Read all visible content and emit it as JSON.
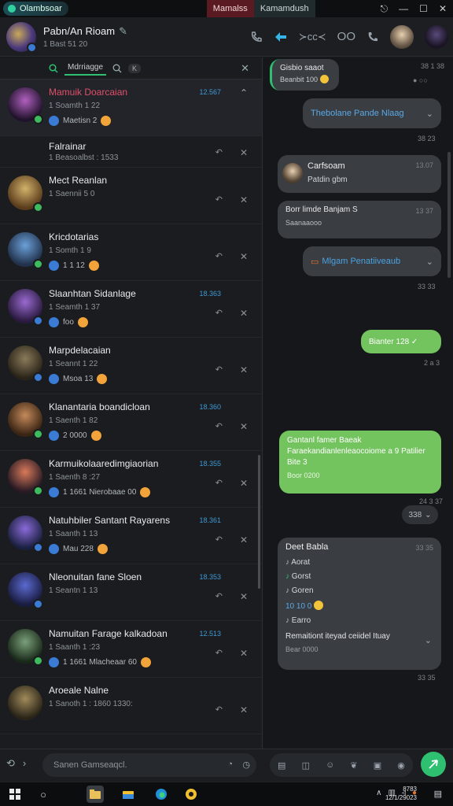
{
  "titlebar": {
    "app_name": "Olambsoar",
    "tab_active": "Mamalss",
    "tab_inactive": "Kamamdush",
    "controls": [
      "⎋",
      "—",
      "☐",
      "✕"
    ]
  },
  "header": {
    "title": "Pabn/An Rioam",
    "subtitle": "1 Bast 51 20",
    "actions": [
      "phone-icon",
      "forward-icon",
      "bell-icon",
      "mute-icon",
      "call-icon"
    ],
    "mute_label": "OO",
    "bell_label": "≻cc≺"
  },
  "search": {
    "label": "Mdrriagge",
    "tag": "K"
  },
  "conversations": [
    {
      "name": "Mamuik Doarcaian",
      "line2": "1 Soamth 1 22",
      "line3": "Maetisn 2",
      "time": "12.567",
      "highlight": true,
      "avatar": [
        "#b060c0",
        "#20122a"
      ],
      "badge": "#3dbb5e"
    },
    {
      "name": "Falrainar",
      "line2": "1 Beasoalbst : 1533",
      "line3": "",
      "time": "",
      "highlight": false,
      "avatar": [
        "#1a1c1f",
        "#1a1c1f"
      ],
      "badge": ""
    },
    {
      "name": "Mect Reanlan",
      "line2": "1 Saennii 5 0",
      "line3": "",
      "time": "",
      "highlight": false,
      "avatar": [
        "#d2b26a",
        "#5a3c1c"
      ],
      "badge": "#3dbb5e"
    },
    {
      "name": "Kricdotarias",
      "line2": "1 Somth 1 9",
      "line3": "1 1 12",
      "time": "",
      "highlight": false,
      "avatar": [
        "#6aa0d8",
        "#22324c"
      ],
      "badge": "#3dbb5e"
    },
    {
      "name": "Slaanhtan Sidanlage",
      "line2": "1 Seamth 1 37",
      "line3": "foo",
      "time": "18.363",
      "highlight": false,
      "avatar": [
        "#9a6ad0",
        "#2a1a40"
      ],
      "badge": "#3a7bd5"
    },
    {
      "name": "Marpdelacaian",
      "line2": "1 Seannt 1 22",
      "line3": "Msoa 13",
      "time": "",
      "highlight": false,
      "avatar": [
        "#8a7a5a",
        "#2a2418"
      ],
      "badge": "#3a7bd5"
    },
    {
      "name": "Klanantaria boandicloan",
      "line2": "1 Saenth 1 82",
      "line3": "2 0000",
      "time": "18.360",
      "highlight": false,
      "avatar": [
        "#c48a5a",
        "#3a2414"
      ],
      "badge": "#3dbb5e"
    },
    {
      "name": "Karmuikolaaredimgiaorian",
      "line2": "1 Saenth 8 :27",
      "line3": "1 1661 Nierobaae 00",
      "time": "18.355",
      "highlight": false,
      "avatar": [
        "#d87a5a",
        "#2a1a24"
      ],
      "badge": "#3dbb5e"
    },
    {
      "name": "Natuhbiler Santant Rayarens",
      "line2": "1 Saanth 1 13",
      "line3": "Mau 228",
      "time": "18.361",
      "highlight": false,
      "avatar": [
        "#8a6ad8",
        "#1a2040"
      ],
      "badge": "#3a7bd5"
    },
    {
      "name": "Nleonuitan fane Sloen",
      "line2": "1 Seantn 1 13",
      "line3": "",
      "time": "18.353",
      "highlight": false,
      "avatar": [
        "#5a6ad0",
        "#1a1c40"
      ],
      "badge": "#3a7bd5"
    },
    {
      "name": "Namuitan Farage kalkadoan",
      "line2": "1 Saanth 1 :23",
      "line3": "1 1661 Mlacheaar 60",
      "time": "12.513",
      "highlight": false,
      "avatar": [
        "#7aa07a",
        "#1a2a1a"
      ],
      "badge": "#3dbb5e"
    },
    {
      "name": "Aroeale Nalne",
      "line2": "1 Sanoth 1 : 1860 1330:",
      "line3": "",
      "time": "",
      "highlight": false,
      "avatar": [
        "#a08a5a",
        "#2a2418"
      ],
      "badge": ""
    }
  ],
  "messages": [
    {
      "kind": "in",
      "text": "Gisbio saaot",
      "sub": "Beanbit 100",
      "meta": "38 1 38"
    },
    {
      "kind": "out-blue",
      "text": "Thebolane Pande Nlaag",
      "meta": "38 23"
    },
    {
      "kind": "in-card",
      "name": "Carfsoam",
      "text": "Patdin gbm",
      "meta": "13.07"
    },
    {
      "kind": "in",
      "text": "Borr limde Banjam S",
      "sub": "Saanaaooo",
      "meta": "13 37"
    },
    {
      "kind": "out-orange",
      "text": "Mlgam Penatiiveaub",
      "meta": "33 33"
    },
    {
      "kind": "out-green",
      "text": "Bianter 128 ✓",
      "meta": "2 a 3"
    },
    {
      "kind": "out-green-long",
      "text": "Gantanl famer Baeak Faraekandianlenleaocoiome a 9 Patilier Bite 3",
      "sub": "Boor 0200",
      "meta": "24 3 37"
    },
    {
      "kind": "chip",
      "text": "338"
    },
    {
      "kind": "in-list",
      "title": "Deet Babla",
      "items": [
        "Aorat",
        "Gorst",
        "Goren",
        "10 10 0",
        "Earro"
      ],
      "footer": "Remaitiont iteyad ceiidel Ituay",
      "sub": "Bear 0000",
      "meta": "33 35"
    }
  ],
  "composer": {
    "placeholder": "Sanen Gamseaqcl.",
    "tools": [
      "keyboard-icon",
      "attach-icon",
      "emoji-icon",
      "gif-icon",
      "image-icon",
      "sticker-icon"
    ]
  },
  "taskbar": {
    "time": "8783",
    "date": "12/1/29023"
  }
}
